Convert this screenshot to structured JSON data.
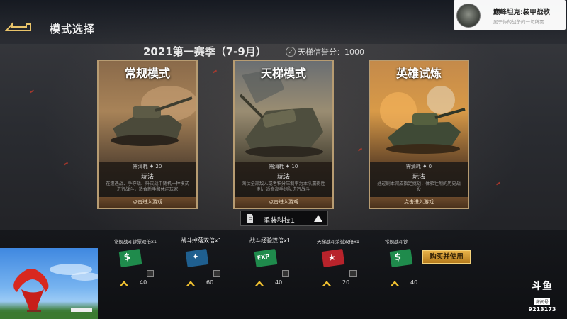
{
  "header": {
    "title": "模式选择",
    "season": "2021第一赛季（7-9月）",
    "credit_label": "天梯信誉分：1000"
  },
  "channel": {
    "name": "巅峰坦克:装甲战歌",
    "subtitle": "属于你的战争的一切所需"
  },
  "modes": [
    {
      "title": "常规模式",
      "cost_label": "需消耗",
      "cost_value": "20",
      "play_label": "玩法",
      "desc": "在遭遇战、争夺战、歼灭战中随机一种模式进行战斗，适合新手和休闲玩家",
      "enter_label": "点击进入游戏"
    },
    {
      "title": "天梯模式",
      "cost_label": "需消耗",
      "cost_value": "10",
      "play_label": "玩法",
      "desc": "淘汰全部敌人或者积分压制率为本队赢得胜利，适合高手组队进行战斗",
      "enter_label": "点击进入游戏"
    },
    {
      "title": "英雄试炼",
      "cost_label": "需消耗",
      "cost_value": "0",
      "play_label": "玩法",
      "desc": "通过剧本完成指定挑战，体验壮烈的历史战役",
      "enter_label": "点击进入游戏"
    }
  ],
  "tech": {
    "label": "重装科技1"
  },
  "items": [
    {
      "title": "常规战斗钞票双倍x1",
      "count": "40",
      "box_color": "#1f8b4c",
      "icon": "dollar-icon",
      "glyph": "$"
    },
    {
      "title": "战斗掉落双倍x1",
      "count": "60",
      "box_color": "#1f5f8f",
      "icon": "drop-icon",
      "glyph": "✦"
    },
    {
      "title": "战斗经验双倍x1",
      "count": "40",
      "box_color": "#1f8b4c",
      "icon": "exp-icon",
      "glyph": "EXP"
    },
    {
      "title": "天梯战斗荣誉双倍x1",
      "count": "20",
      "box_color": "#b8232b",
      "icon": "star-icon",
      "glyph": "★"
    },
    {
      "title": "常规战斗钞",
      "count": "40",
      "box_color": "#1f8b4c",
      "icon": "dollar-icon",
      "glyph": "$"
    }
  ],
  "buy_button": "购买并使用",
  "watermark": {
    "logo": "斗鱼",
    "room_label": "房间号",
    "room_number": "9213173"
  },
  "colors": {
    "card_border": "#b79c72",
    "buy_gold": "#e8b248"
  }
}
